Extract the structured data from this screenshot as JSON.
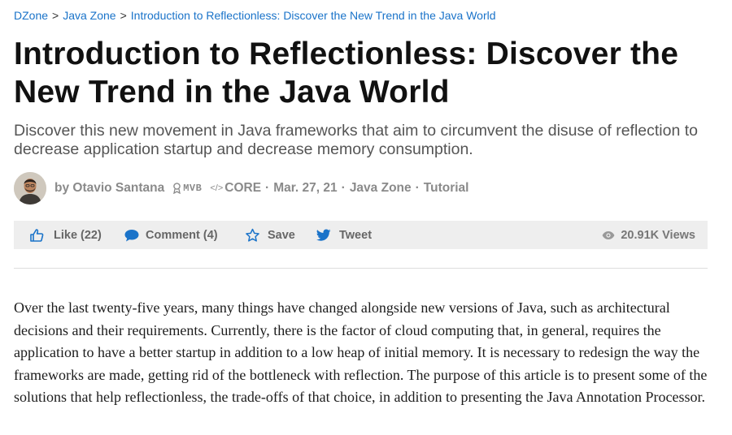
{
  "breadcrumb": {
    "items": [
      "DZone",
      "Java Zone",
      "Introduction to Reflectionless: Discover the New Trend in the Java World"
    ],
    "separator": ">"
  },
  "article": {
    "title": "Introduction to Reflectionless: Discover the New Trend in the Java World",
    "subtitle": "Discover this new movement in Java frameworks that aim to circumvent the disuse of reflection to decrease application startup and decrease memory consumption.",
    "author": "by Otavio Santana",
    "badge_mvb": "MVB",
    "badge_core": "CORE",
    "badge_core_prefix": "</>",
    "date": "Mar. 27, 21",
    "zone": "Java Zone",
    "type": "Tutorial",
    "dot": "·"
  },
  "actions": {
    "like": "Like (22)",
    "comment": "Comment (4)",
    "save": "Save",
    "tweet": "Tweet",
    "views": "20.91K Views"
  },
  "body": {
    "paragraph": "Over the last twenty-five years, many things have changed alongside new versions of Java, such as architectural decisions and their requirements. Currently, there is the factor of cloud computing that, in general, requires the application to have a better startup in addition to a low heap of initial memory. It is necessary to redesign the way the frameworks are made, getting rid of the bottleneck with reflection. The purpose of this article is to present some of the solutions that help reflectionless, the trade-offs of that choice, in addition to presenting the Java Annotation Processor."
  },
  "colors": {
    "link": "#1a73c9",
    "action_icon": "#1a73c9",
    "action_bar_bg": "#eeeeee"
  },
  "icons": [
    "thumbs-up-icon",
    "comment-icon",
    "star-icon",
    "twitter-icon",
    "eye-icon",
    "mvb-badge-icon",
    "code-icon"
  ]
}
